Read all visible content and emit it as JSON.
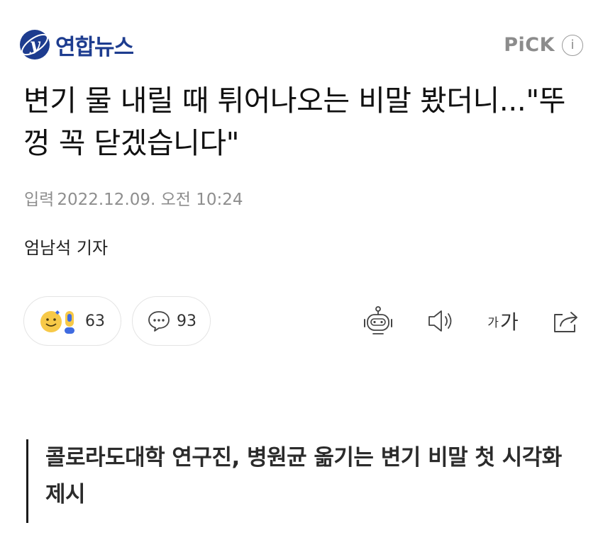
{
  "header": {
    "brand": "연합뉴스",
    "logo_icon": "yonhap-logo-icon",
    "pick_label": "PiCK",
    "pick_info": "i"
  },
  "article": {
    "title": "변기 물 내릴 때 튀어나오는 비말 봤더니...\"뚜껑 꼭 닫겠습니다\"",
    "date_label": "입력",
    "date_value": "2022.12.09. 오전 10:24",
    "reporter": "엄남석 기자",
    "subheading": "콜로라도대학 연구진, 병원균 옮기는 변기 비말 첫 시각화 제시"
  },
  "actions": {
    "reaction_count": "63",
    "comment_count": "93",
    "font_small": "가",
    "font_large": "가",
    "icons": [
      "emoji-reaction-icon",
      "comment-bubble-icon",
      "robot-summary-icon",
      "speaker-icon",
      "font-size-icon",
      "share-icon"
    ]
  },
  "colors": {
    "brand_blue": "#1d3c8f",
    "muted_gray": "#8e8e8e",
    "reaction_yellow": "#f7c948",
    "reaction_blue": "#3f6be0"
  }
}
